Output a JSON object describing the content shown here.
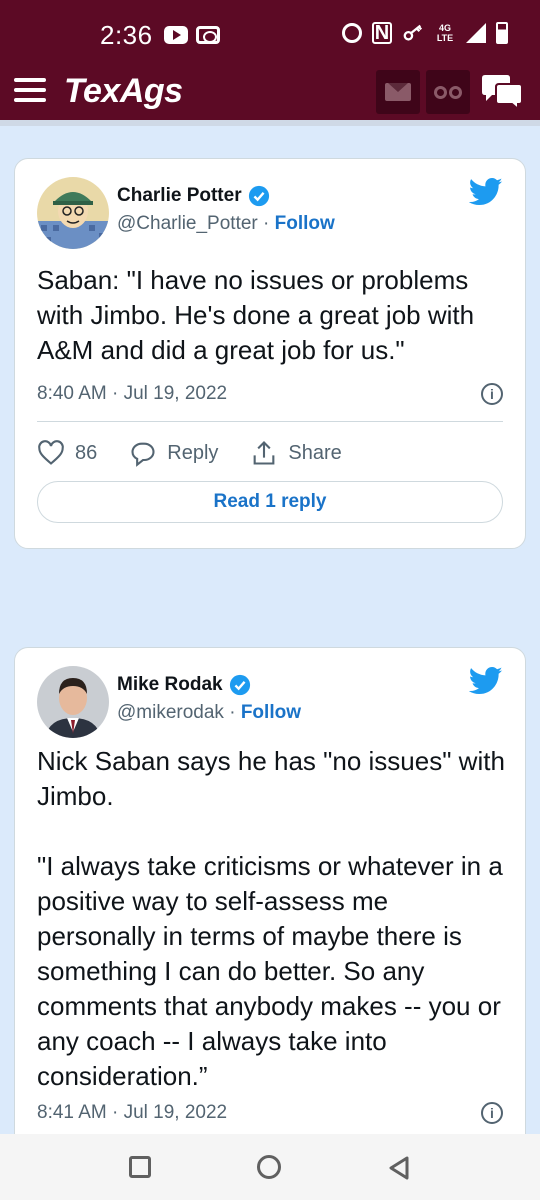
{
  "status_bar": {
    "time": "2:36",
    "network_label": "4G LTE"
  },
  "app_header": {
    "logo": "TexAgs"
  },
  "tweets": [
    {
      "author_name": "Charlie Potter",
      "handle": "@Charlie_Potter",
      "separator": " · ",
      "follow_label": "Follow",
      "text": "Saban: \"I have no issues or problems with Jimbo. He's done a great job with A&M and did a great job for us.\"",
      "timestamp": "8:40 AM · Jul 19, 2022",
      "like_count": "86",
      "reply_label": "Reply",
      "share_label": "Share",
      "read_replies_label": "Read 1 reply"
    },
    {
      "author_name": "Mike Rodak",
      "handle": "@mikerodak",
      "separator": " · ",
      "follow_label": "Follow",
      "text": "Nick Saban says he has \"no issues\" with Jimbo.\n\n\"I always take criticisms or whatever in a positive way to self-assess me personally in terms of maybe there is something I can do better. So any comments that anybody makes -- you or any coach -- I always take into consideration.”",
      "timestamp": "8:41 AM · Jul 19, 2022"
    }
  ],
  "colors": {
    "brand_maroon": "#5c0a25",
    "twitter_blue": "#1d9bf0",
    "link_blue": "#1a73c8",
    "page_background": "#dbeafb"
  },
  "icons": {
    "menu": "hamburger-icon",
    "mail": "mail-icon",
    "binoculars": "binoculars-icon",
    "chat": "chat-bubbles-icon",
    "verified": "verified-badge-icon",
    "twitter": "twitter-bird-icon",
    "info": "info-icon",
    "like": "heart-icon",
    "reply": "reply-icon",
    "share": "share-icon"
  }
}
